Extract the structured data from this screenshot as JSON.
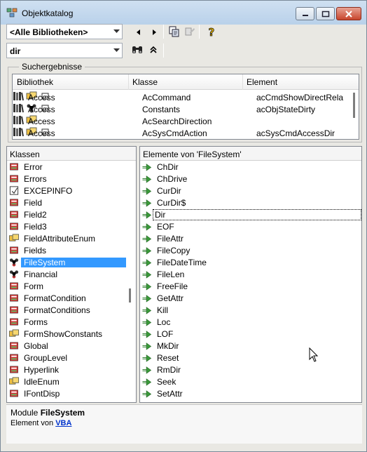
{
  "window": {
    "title": "Objektkatalog"
  },
  "toolbar": {
    "library_combo": "<Alle Bibliotheken>",
    "search_combo": "dir"
  },
  "results": {
    "group_label": "Suchergebnisse",
    "columns": [
      "Bibliothek",
      "Klasse",
      "Element"
    ],
    "rows": [
      {
        "library": "Access",
        "class": "AcCommand",
        "element": "acCmdShowDirectRela"
      },
      {
        "library": "Access",
        "class": "Constants",
        "element": "acObjStateDirty"
      },
      {
        "library": "Access",
        "class": "AcSearchDirection",
        "element": ""
      },
      {
        "library": "Access",
        "class": "AcSysCmdAction",
        "element": "acSysCmdAccessDir"
      }
    ]
  },
  "classes": {
    "header": "Klassen",
    "items": [
      {
        "label": "Error",
        "icon": "class-icon"
      },
      {
        "label": "Errors",
        "icon": "class-icon"
      },
      {
        "label": "EXCEPINFO",
        "icon": "type-icon"
      },
      {
        "label": "Field",
        "icon": "class-icon"
      },
      {
        "label": "Field2",
        "icon": "class-icon"
      },
      {
        "label": "Field3",
        "icon": "class-icon"
      },
      {
        "label": "FieldAttributeEnum",
        "icon": "enum-icon"
      },
      {
        "label": "Fields",
        "icon": "class-icon"
      },
      {
        "label": "FileSystem",
        "icon": "module-icon",
        "selected": true
      },
      {
        "label": "Financial",
        "icon": "module-icon"
      },
      {
        "label": "Form",
        "icon": "class-icon"
      },
      {
        "label": "FormatCondition",
        "icon": "class-icon"
      },
      {
        "label": "FormatConditions",
        "icon": "class-icon"
      },
      {
        "label": "Forms",
        "icon": "class-icon"
      },
      {
        "label": "FormShowConstants",
        "icon": "enum-icon"
      },
      {
        "label": "Global",
        "icon": "class-icon"
      },
      {
        "label": "GroupLevel",
        "icon": "class-icon"
      },
      {
        "label": "Hyperlink",
        "icon": "class-icon"
      },
      {
        "label": "IdleEnum",
        "icon": "enum-icon"
      },
      {
        "label": "IFontDisp",
        "icon": "class-icon"
      }
    ]
  },
  "members": {
    "header": "Elemente von 'FileSystem'",
    "items": [
      {
        "label": "ChDir"
      },
      {
        "label": "ChDrive"
      },
      {
        "label": "CurDir"
      },
      {
        "label": "CurDir$"
      },
      {
        "label": "Dir",
        "focused": true
      },
      {
        "label": "EOF"
      },
      {
        "label": "FileAttr"
      },
      {
        "label": "FileCopy"
      },
      {
        "label": "FileDateTime"
      },
      {
        "label": "FileLen"
      },
      {
        "label": "FreeFile"
      },
      {
        "label": "GetAttr"
      },
      {
        "label": "Kill"
      },
      {
        "label": "Loc"
      },
      {
        "label": "LOF"
      },
      {
        "label": "MkDir"
      },
      {
        "label": "Reset"
      },
      {
        "label": "RmDir"
      },
      {
        "label": "Seek"
      },
      {
        "label": "SetAttr"
      }
    ]
  },
  "description": {
    "line1_prefix": "Module",
    "line1_name": "FileSystem",
    "line2_prefix": "Element von",
    "line2_link": "VBA"
  }
}
